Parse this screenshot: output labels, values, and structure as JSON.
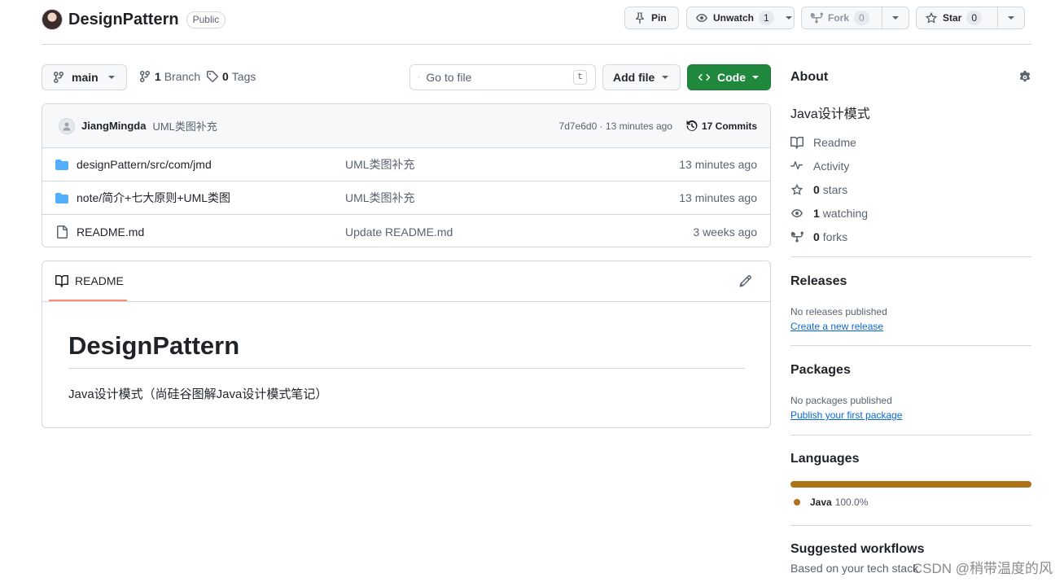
{
  "repo": {
    "name": "DesignPattern",
    "visibility": "Public"
  },
  "header_buttons": {
    "pin": "Pin",
    "unwatch": "Unwatch",
    "unwatch_count": "1",
    "fork": "Fork",
    "fork_count": "0",
    "star": "Star",
    "star_count": "0"
  },
  "toolbar": {
    "branch": "main",
    "branch_count": "1",
    "branch_label": "Branch",
    "tag_count": "0",
    "tag_label": "Tags",
    "search_placeholder": "Go to file",
    "search_shortcut": "t",
    "add_file": "Add file",
    "code": "Code"
  },
  "latest_commit": {
    "author": "JiangMingda",
    "message": "UML类图补充",
    "hash_time": "7d7e6d0 · 13 minutes ago",
    "commits": "17 Commits"
  },
  "files": [
    {
      "type": "folder",
      "name": "designPattern/src/com/jmd",
      "message": "UML类图补充",
      "time": "13 minutes ago"
    },
    {
      "type": "folder",
      "name": "note/简介+七大原则+UML类图",
      "message": "UML类图补充",
      "time": "13 minutes ago"
    },
    {
      "type": "file",
      "name": "README.md",
      "message": "Update README.md",
      "time": "3 weeks ago"
    }
  ],
  "readme": {
    "tab": "README",
    "title": "DesignPattern",
    "description": "Java设计模式（尚硅谷图解Java设计模式笔记）"
  },
  "about": {
    "heading": "About",
    "description": "Java设计模式",
    "readme": "Readme",
    "activity": "Activity",
    "stars_count": "0",
    "stars_label": "stars",
    "watching_count": "1",
    "watching_label": "watching",
    "forks_count": "0",
    "forks_label": "forks"
  },
  "releases": {
    "heading": "Releases",
    "status": "No releases published",
    "link": "Create a new release"
  },
  "packages": {
    "heading": "Packages",
    "status": "No packages published",
    "link": "Publish your first package"
  },
  "languages": {
    "heading": "Languages",
    "items": [
      {
        "name": "Java",
        "percent": "100.0%",
        "color": "#b07219",
        "fraction": 1.0
      }
    ]
  },
  "suggested": {
    "heading": "Suggested workflows",
    "subtitle": "Based on your tech stack"
  },
  "watermark": "CSDN @稍带温度的风",
  "colors": {
    "accent_green": "#1f883d",
    "link_blue": "#0969da",
    "folder_blue": "#54aeff",
    "tab_underline": "#fd8c73"
  }
}
